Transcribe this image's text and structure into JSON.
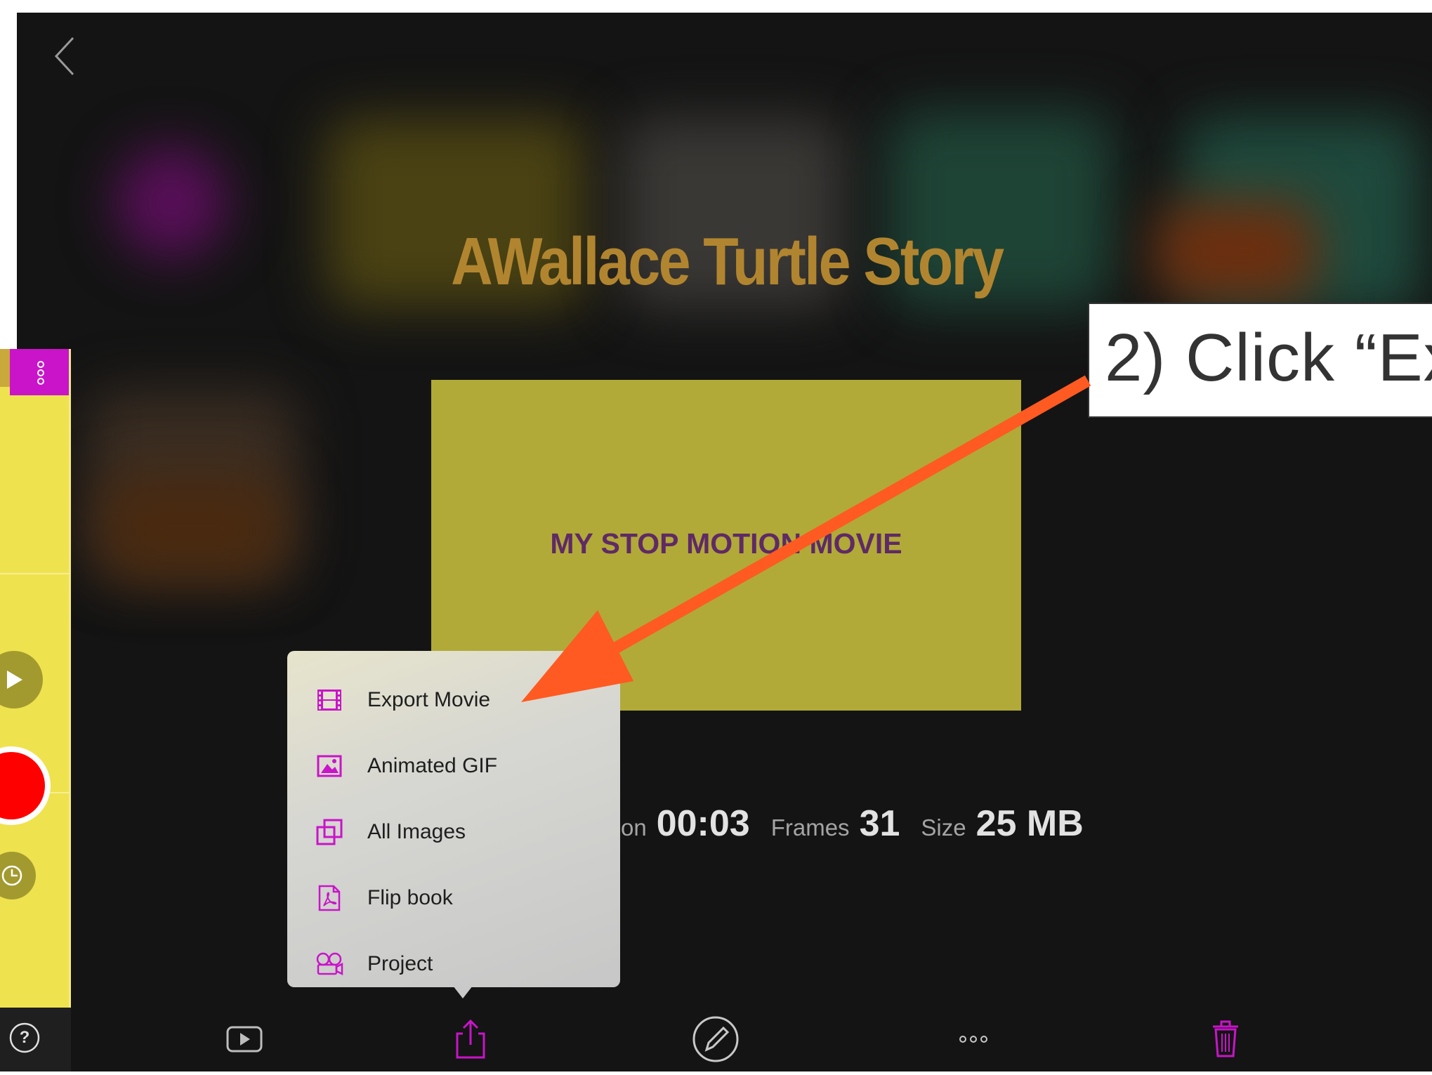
{
  "project": {
    "title": "AWallace Turtle Story",
    "preview_text": "MY STOP MOTION MOVIE"
  },
  "stats": {
    "duration_label": "on",
    "duration_value": "00:03",
    "frames_label": "Frames",
    "frames_value": "31",
    "size_label": "Size",
    "size_value": "25 MB"
  },
  "export_menu": {
    "items": [
      {
        "label": "Export Movie",
        "icon": "film-strip-icon"
      },
      {
        "label": "Animated GIF",
        "icon": "image-icon"
      },
      {
        "label": "All Images",
        "icon": "stacked-images-icon"
      },
      {
        "label": "Flip book",
        "icon": "pdf-icon"
      },
      {
        "label": "Project",
        "icon": "movie-camera-icon"
      }
    ]
  },
  "toolbar": {
    "items": [
      "play-icon",
      "share-icon",
      "edit-icon",
      "more-icon",
      "trash-icon"
    ]
  },
  "side_panel": {
    "help_label": "?"
  },
  "annotation": {
    "callout_text": "2) Click “Ex"
  },
  "colors": {
    "accent": "#c914c9",
    "background": "#141414",
    "title": "#b1852f",
    "preview_bg": "#b1aa38",
    "preview_text": "#5f2a66",
    "side_panel": "#efe24f",
    "record": "#ff0000",
    "arrow": "#ff5a22"
  }
}
